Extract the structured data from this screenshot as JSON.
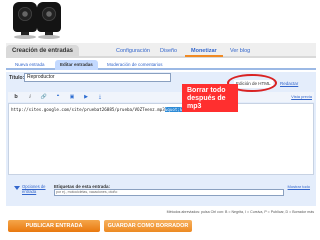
{
  "top_tabs": [
    {
      "label": "Creación de entradas"
    },
    {
      "label": "Configuración"
    },
    {
      "label": "Diseño"
    },
    {
      "label": "Monetizar"
    },
    {
      "label": "Ver blog"
    }
  ],
  "sub_tabs": [
    {
      "label": "Nueva entrada"
    },
    {
      "label": "Editar entradas"
    },
    {
      "label": "Moderación de comentarios"
    }
  ],
  "title_field": {
    "label": "Título:",
    "value": "Reproductor"
  },
  "modes": {
    "html": "Edición de HTML",
    "compose": "Redactar"
  },
  "toolbar": {
    "bold": "b",
    "italic": "i",
    "preview": "Vista previa"
  },
  "editor": {
    "code_start": "http://sites.google.com/site/pruebat26885/prueba/VOZTeenz.mp3",
    "code_end": "&quot;&gt;&lt;/embed&gt;"
  },
  "callout": {
    "line1": "Borrar todo",
    "line2": "después de mp3"
  },
  "post_options": {
    "link": "Opciones de entrada",
    "labels_title": "Etiquetas de esta entrada:",
    "labels_hint": "por ej., motocicletas, vacaciones, otoño",
    "show_all": "Mostrar todo"
  },
  "shortcuts": "Métodos abreviados: pulsa Ctrl con: B = Negrita, I = Cursiva, P = Publicar, D = Borrador más",
  "buttons": {
    "publish": "PUBLICAR ENTRADA",
    "draft": "GUARDAR COMO BORRADOR"
  }
}
